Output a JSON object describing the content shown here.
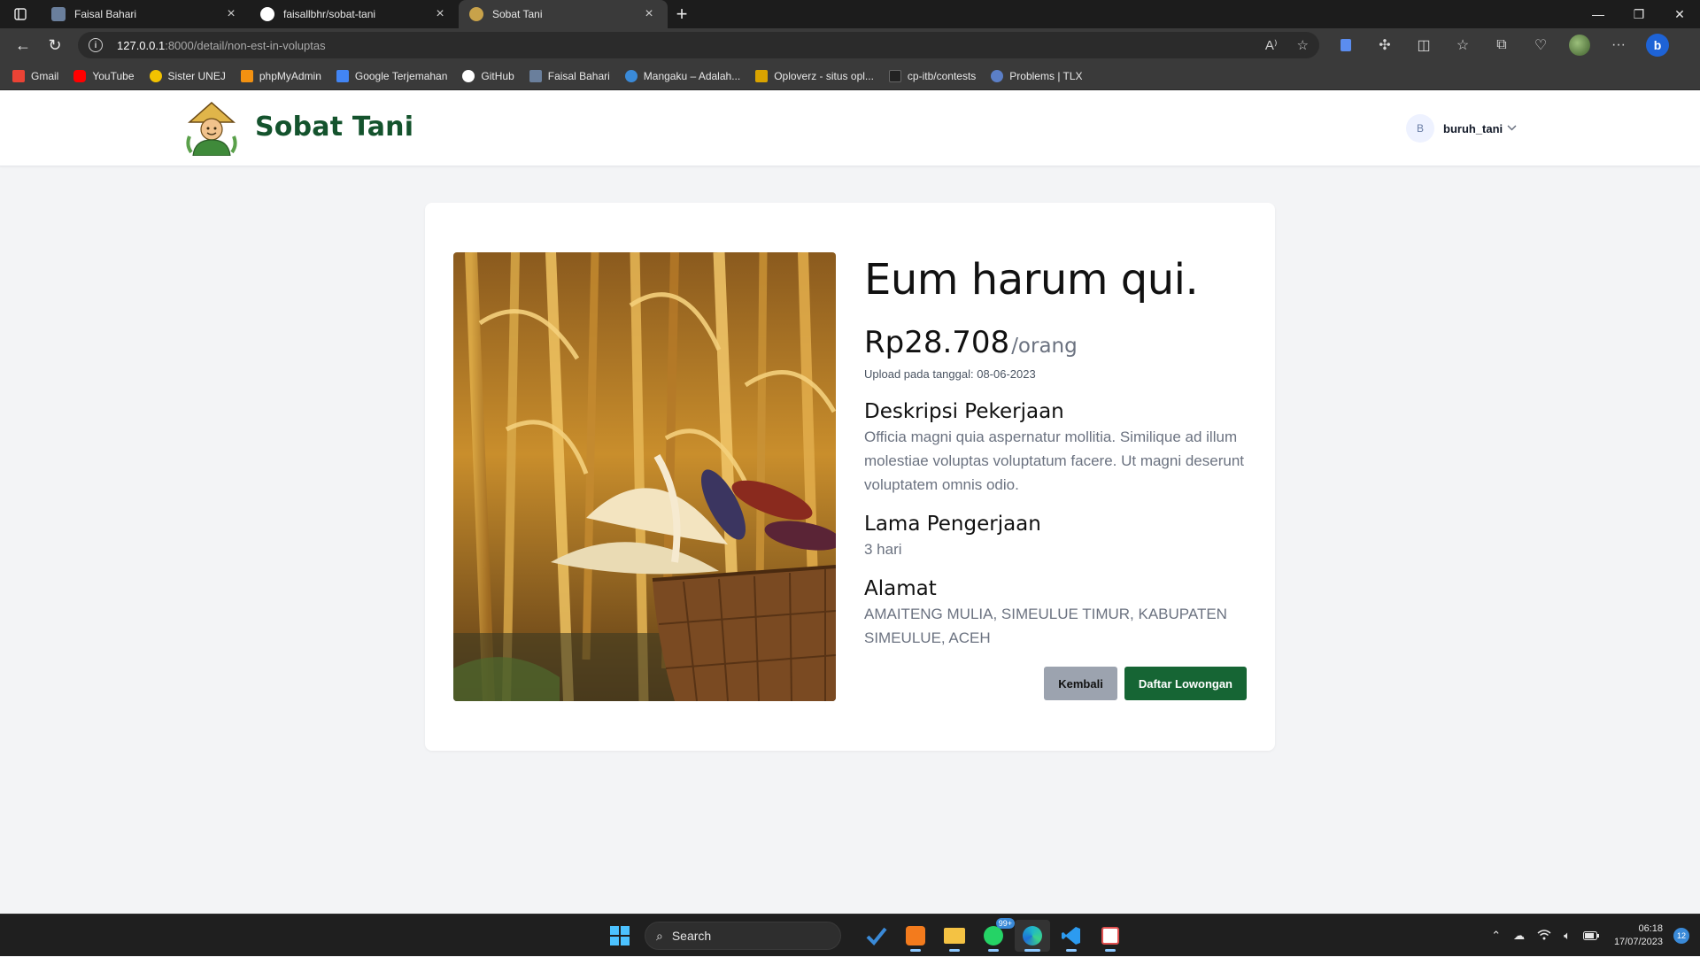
{
  "browser": {
    "tabs": [
      {
        "title": "Faisal Bahari",
        "favicon_color": "#6a7f9c"
      },
      {
        "title": "faisallbhr/sobat-tani",
        "favicon_color": "#ffffff"
      },
      {
        "title": "Sobat Tani",
        "favicon_color": "#c8a24a"
      }
    ],
    "active_tab": 2,
    "url_host": "127.0.0.1",
    "url_path": ":8000/detail/non-est-in-voluptas",
    "bookmarks": [
      {
        "label": "Gmail",
        "color": "#ea4335"
      },
      {
        "label": "YouTube",
        "color": "#ff0000"
      },
      {
        "label": "Sister UNEJ",
        "color": "#f2c200"
      },
      {
        "label": "phpMyAdmin",
        "color": "#f29111"
      },
      {
        "label": "Google Terjemahan",
        "color": "#4285f4"
      },
      {
        "label": "GitHub",
        "color": "#ffffff"
      },
      {
        "label": "Faisal Bahari",
        "color": "#6a7f9c"
      },
      {
        "label": "Mangaku – Adalah...",
        "color": "#3a8ad8"
      },
      {
        "label": "Oploverz - situs opl...",
        "color": "#d9a300"
      },
      {
        "label": "cp-itb/contests",
        "color": "#222222"
      },
      {
        "label": "Problems | TLX",
        "color": "#5b7fc7"
      }
    ]
  },
  "site": {
    "brand": "Sobat Tani",
    "brand_color": "#14532d",
    "user_initial": "B",
    "username": "buruh_tani"
  },
  "job": {
    "title": "Eum harum qui.",
    "price": "Rp28.708",
    "unit": "/orang",
    "upload": "Upload pada tanggal: 08-06-2023",
    "desc_heading": "Deskripsi Pekerjaan",
    "description": "Officia magni quia aspernatur mollitia. Similique ad illum molestiae voluptas voluptatum facere. Ut magni deserunt voluptatem omnis odio.",
    "duration_heading": "Lama Pengerjaan",
    "duration": "3 hari",
    "address_heading": "Alamat",
    "address": "AMAITENG MULIA, SIMEULUE TIMUR, KABUPATEN SIMEULUE, ACEH",
    "back_label": "Kembali",
    "apply_label": "Daftar Lowongan"
  },
  "taskbar": {
    "search_label": "Search",
    "whatsapp_badge": "99+",
    "time": "06:18",
    "date": "17/07/2023",
    "notifications": "12"
  }
}
